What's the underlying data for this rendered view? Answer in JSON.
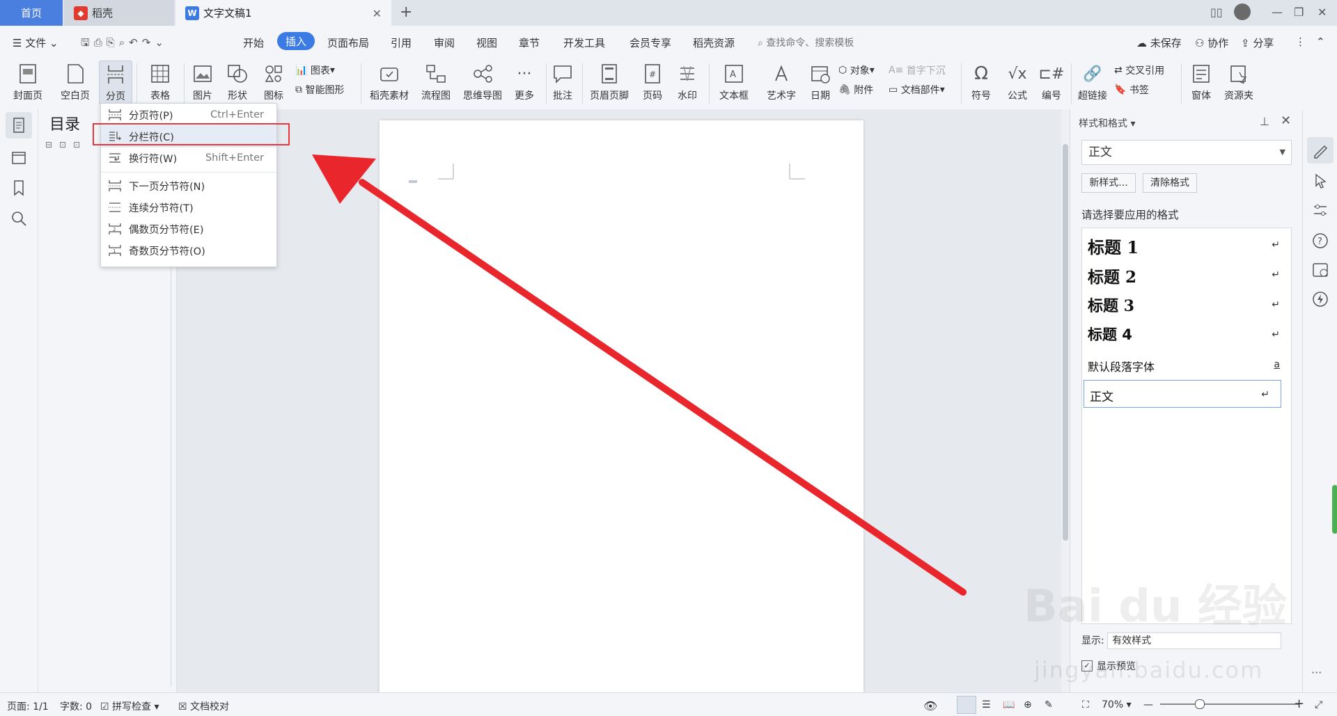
{
  "tabs": {
    "home": "首页",
    "daoke": "稻壳",
    "doc": "文字文稿1"
  },
  "menu": {
    "file": "文件",
    "items": [
      "开始",
      "插入",
      "页面布局",
      "引用",
      "审阅",
      "视图",
      "章节",
      "开发工具",
      "会员专享",
      "稻壳资源"
    ],
    "active": "插入",
    "search_placeholder": "查找命令、搜索模板",
    "unsaved": "未保存",
    "collab": "协作",
    "share": "分享"
  },
  "ribbon": {
    "cover": "封面页",
    "blank": "空白页",
    "pagebreak": "分页",
    "table": "表格",
    "picture": "图片",
    "shape": "形状",
    "icon": "图标",
    "chart": "图表",
    "smart": "智能图形",
    "material": "稻壳素材",
    "flow": "流程图",
    "mind": "思维导图",
    "more": "更多",
    "comment": "批注",
    "header": "页眉页脚",
    "pagenum": "页码",
    "watermark": "水印",
    "textbox": "文本框",
    "wordart": "艺术字",
    "date": "日期",
    "object": "对象",
    "attach": "附件",
    "dropcap": "首字下沉",
    "docpart": "文档部件",
    "symbol": "符号",
    "formula": "公式",
    "numbering": "编号",
    "xref": "交叉引用",
    "hyperlink": "超链接",
    "bookmark": "书签",
    "window": "窗体",
    "resource": "资源夹"
  },
  "dropdown": {
    "items": [
      {
        "label": "分页符(P)",
        "shortcut": "Ctrl+Enter"
      },
      {
        "label": "分栏符(C)",
        "shortcut": ""
      },
      {
        "label": "换行符(W)",
        "shortcut": "Shift+Enter"
      },
      {
        "label": "下一页分节符(N)",
        "shortcut": ""
      },
      {
        "label": "连续分节符(T)",
        "shortcut": ""
      },
      {
        "label": "偶数页分节符(E)",
        "shortcut": ""
      },
      {
        "label": "奇数页分节符(O)",
        "shortcut": ""
      }
    ],
    "highlighted": "分栏符(C)"
  },
  "toc": {
    "title": "目录"
  },
  "panel": {
    "title": "样式和格式",
    "current": "正文",
    "new_style": "新样式...",
    "clear": "清除格式",
    "choose_label": "请选择要应用的格式",
    "styles": [
      {
        "name": "标题  1",
        "mark": "↵"
      },
      {
        "name": "标题  2",
        "mark": "↵"
      },
      {
        "name": "标题  3",
        "mark": "↵"
      },
      {
        "name": "标题  4",
        "mark": "↵"
      },
      {
        "name": "默认段落字体",
        "mark": "a"
      },
      {
        "name": "正文",
        "mark": "↵"
      }
    ],
    "show_label": "显示:",
    "show_value": "有效样式",
    "preview": "显示预览"
  },
  "status": {
    "page": "页面: 1/1",
    "words": "字数: 0",
    "spell": "拼写检查",
    "proof": "文档校对",
    "zoom": "70%"
  },
  "watermark": {
    "line1": "Bai du 经验",
    "line2": "jingyan.baidu.com"
  },
  "colors": {
    "accent": "#3c7be3",
    "arrow": "#e8262c",
    "highlight_box": "#e8363c"
  }
}
